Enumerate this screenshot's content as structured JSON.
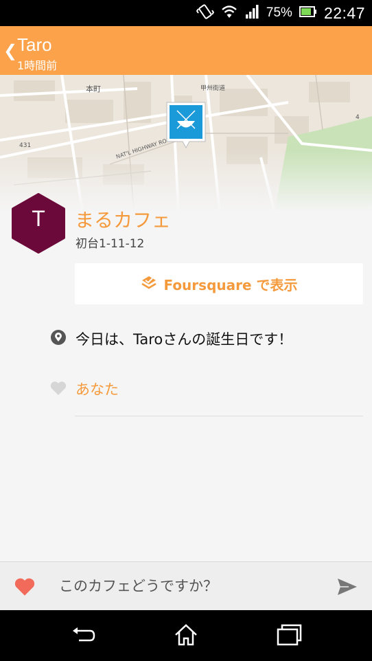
{
  "status_bar": {
    "battery_percent": "75%",
    "time": "22:47",
    "icons": [
      "vibrate-icon",
      "wifi-icon",
      "signal-icon",
      "battery-icon"
    ]
  },
  "header": {
    "title": "Taro",
    "subtitle": "1時間前"
  },
  "map": {
    "labels": [
      "本町",
      "431",
      "NAT'L HIGHWAY ROUTE",
      "甲州街道",
      "4"
    ]
  },
  "checkin": {
    "avatar_letter": "T",
    "avatar_color": "#6b0a3a",
    "venue_name": "まるカフェ",
    "venue_address": "初台1-11-12",
    "foursquare_button": "Foursquare で表示",
    "shout": "今日は、Taroさんの誕生日です！",
    "likes": "あなた"
  },
  "comment": {
    "placeholder": "このカフェどうですか？"
  },
  "colors": {
    "accent": "#f59a3c",
    "header_bg": "#fba24a",
    "map_pin": "#1a9ad9"
  }
}
